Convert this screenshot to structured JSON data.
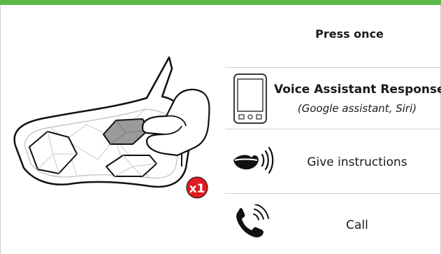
{
  "header": {
    "accent_color": "#5cb946"
  },
  "instruction": {
    "press_label": "Press once"
  },
  "device": {
    "badge": "x1",
    "badge_color": "#e01b22"
  },
  "rows": [
    {
      "icon": "smartphone-icon",
      "title": "Voice Assistant Response",
      "subtitle": "(Google assistant, Siri)"
    },
    {
      "icon": "speaking-mouth-icon",
      "label": "Give instructions"
    },
    {
      "icon": "phone-call-icon",
      "label": "Call"
    }
  ]
}
